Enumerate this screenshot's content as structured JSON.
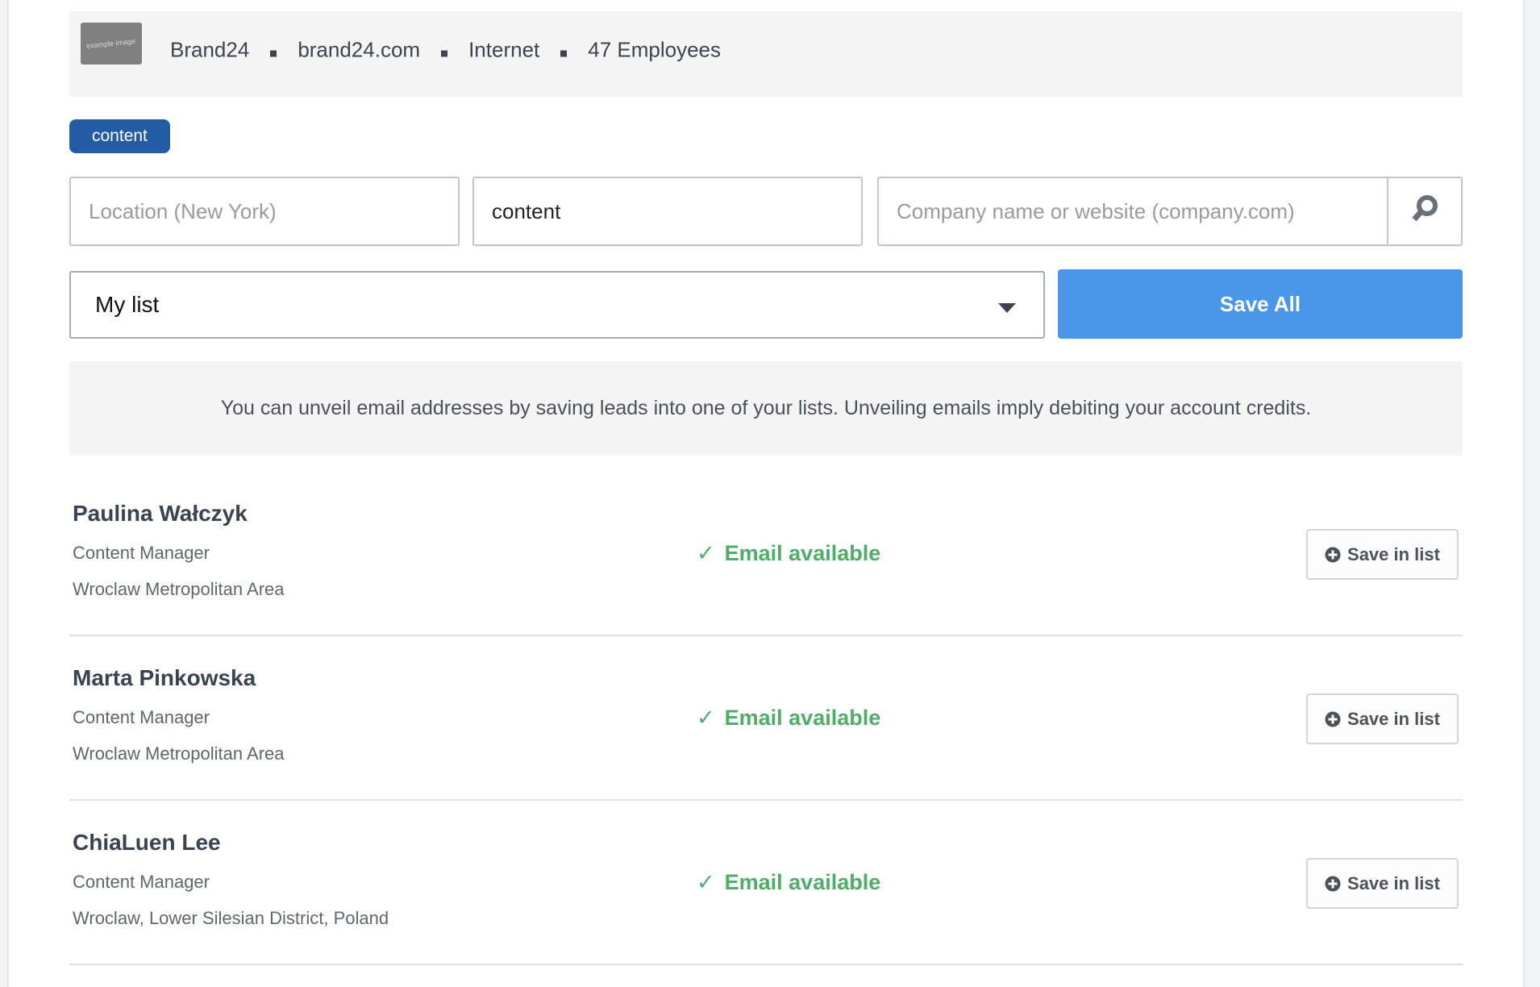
{
  "company": {
    "logo_alt": "example image",
    "name": "Brand24",
    "website": "brand24.com",
    "industry": "Internet",
    "employees": "47 Employees"
  },
  "active_tag": "content",
  "search": {
    "location_placeholder": "Location (New York)",
    "location_value": "",
    "keyword_value": "content",
    "company_placeholder": "Company name or website (company.com)",
    "company_value": "",
    "search_icon": "search-icon"
  },
  "list_select": {
    "selected": "My list"
  },
  "save_all_label": "Save All",
  "info_message": "You can unveil email addresses by saving leads into one of your lists. Unveiling emails imply debiting your account credits.",
  "colors": {
    "tag_bg": "#245ca3",
    "primary_button": "#4a96e8",
    "email_available": "#4ead69"
  },
  "leads": [
    {
      "name": "Paulina Wałczyk",
      "title": "Content Manager",
      "location": "Wroclaw Metropolitan Area",
      "status_check": "✓",
      "status": "Email available",
      "action": "Save in list"
    },
    {
      "name": "Marta Pinkowska",
      "title": "Content Manager",
      "location": "Wroclaw Metropolitan Area",
      "status_check": "✓",
      "status": "Email available",
      "action": "Save in list"
    },
    {
      "name": "ChiaLuen Lee",
      "title": "Content Manager",
      "location": "Wroclaw, Lower Silesian District, Poland",
      "status_check": "✓",
      "status": "Email available",
      "action": "Save in list"
    }
  ]
}
